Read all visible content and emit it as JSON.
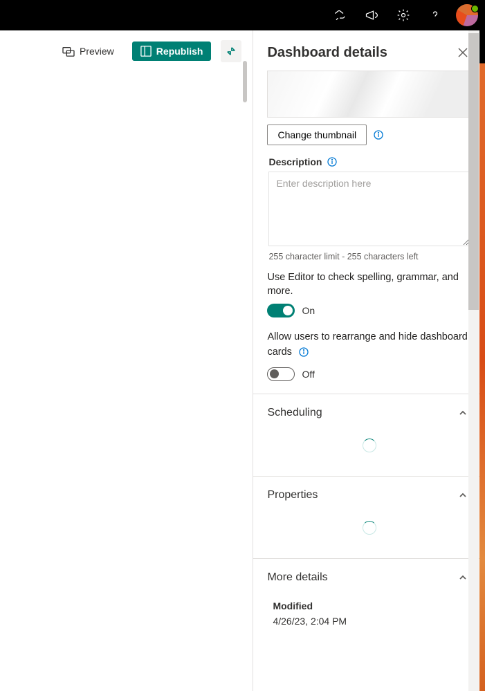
{
  "topbar": {
    "icons": [
      "copilot-icon",
      "megaphone-icon",
      "settings-icon",
      "help-icon"
    ]
  },
  "toolbar": {
    "preview_label": "Preview",
    "republish_label": "Republish"
  },
  "panel": {
    "title": "Dashboard details",
    "change_thumbnail_label": "Change thumbnail",
    "description_label": "Description",
    "description_placeholder": "Enter description here",
    "char_limit_text": "255 character limit - 255 characters left",
    "editor_text": "Use Editor to check spelling, grammar, and more.",
    "editor_toggle_state": "On",
    "rearrange_text": "Allow users to rearrange and hide dashboard cards",
    "rearrange_toggle_state": "Off",
    "sections": {
      "scheduling": "Scheduling",
      "properties": "Properties",
      "more_details": "More details"
    },
    "more_details": {
      "modified_label": "Modified",
      "modified_value": "4/26/23, 2:04 PM"
    }
  }
}
